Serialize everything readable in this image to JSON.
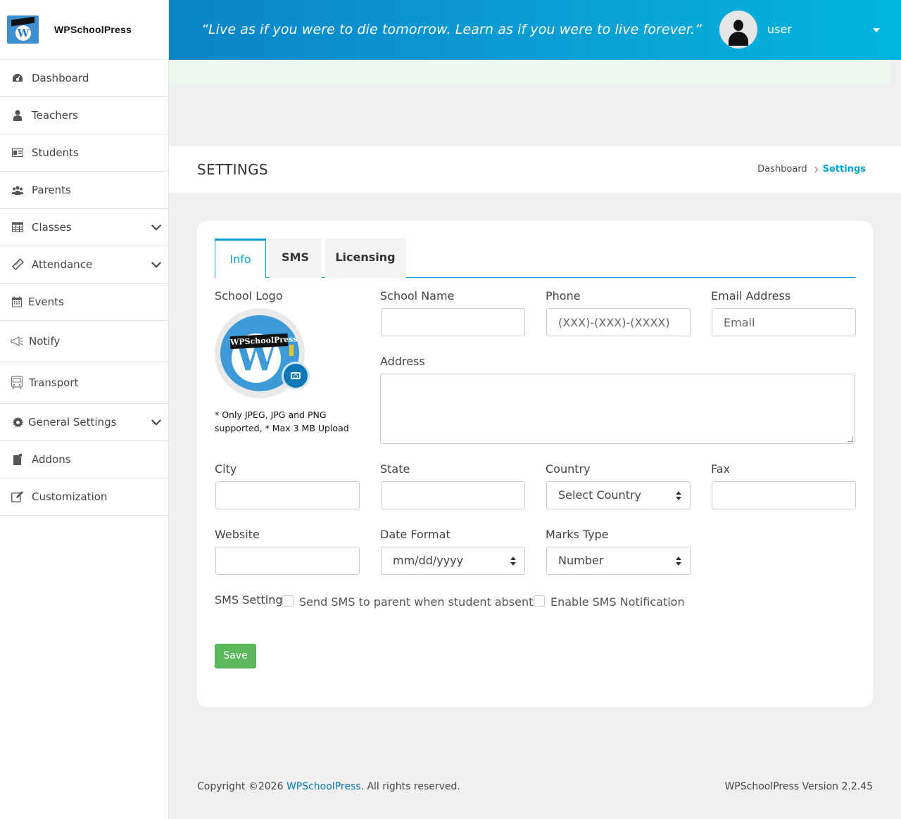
{
  "brand": {
    "name": "WPSchoolPress"
  },
  "header": {
    "quote": "“Live as if you were to die tomorrow. Learn as if you were to live forever.”",
    "user_name": "user"
  },
  "sidebar": {
    "items": [
      {
        "label": "Dashboard",
        "icon": "dashboard-icon"
      },
      {
        "label": "Teachers",
        "icon": "teacher-icon"
      },
      {
        "label": "Students",
        "icon": "id-card-icon"
      },
      {
        "label": "Parents",
        "icon": "users-icon"
      },
      {
        "label": "Classes",
        "icon": "table-icon"
      },
      {
        "label": "Attendance",
        "icon": "ruler-icon"
      },
      {
        "label": "Events",
        "icon": "calendar-icon"
      },
      {
        "label": "Notify",
        "icon": "megaphone-icon"
      },
      {
        "label": "Transport",
        "icon": "bus-icon"
      },
      {
        "label": "General Settings",
        "icon": "gear-icon"
      },
      {
        "label": "Addons",
        "icon": "plugin-icon"
      },
      {
        "label": "Customization",
        "icon": "edit-icon"
      }
    ]
  },
  "page": {
    "title": "SETTINGS",
    "breadcrumb": {
      "home": "Dashboard",
      "current": "Settings"
    }
  },
  "tabs": [
    "Info",
    "SMS",
    "Licensing"
  ],
  "form": {
    "logo_label": "School Logo",
    "logo_text": "WPSchoolPress",
    "logo_note": "* Only JPEG, JPG and PNG supported, * Max 3 MB Upload",
    "school_name_label": "School Name",
    "school_name_value": "",
    "phone_label": "Phone",
    "phone_placeholder": "(XXX)-(XXX)-(XXXX)",
    "email_label": "Email Address",
    "email_placeholder": "Email",
    "address_label": "Address",
    "city_label": "City",
    "state_label": "State",
    "country_label": "Country",
    "country_value": "Select Country",
    "fax_label": "Fax",
    "website_label": "Website",
    "date_format_label": "Date Format",
    "date_format_value": "mm/dd/yyyy",
    "marks_type_label": "Marks Type",
    "marks_type_value": "Number",
    "sms_setting_label": "SMS Setting",
    "sms_absent_label": "Send SMS to parent when student absent",
    "sms_enable_label": "Enable SMS Notification",
    "save_label": "Save"
  },
  "footer": {
    "copyright_prefix": "Copyright ©2026 ",
    "copyright_link": "WPSchoolPress",
    "copyright_suffix": ". All rights reserved.",
    "version": "WPSchoolPress Version 2.2.45"
  },
  "colors": {
    "accent": "#00a4d3",
    "header_start": "#0a84c7",
    "header_end": "#00b5dd",
    "save": "#5cb85c"
  }
}
